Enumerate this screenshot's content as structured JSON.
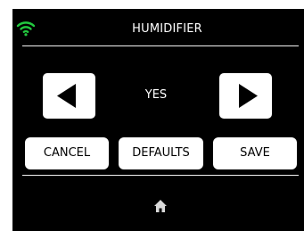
{
  "header": {
    "title": "HUMIDIFIER",
    "wifi_icon": "wifi-icon"
  },
  "selector": {
    "value": "YES",
    "previous_icon": "left-arrow-icon",
    "next_icon": "right-arrow-icon"
  },
  "actions": {
    "cancel_label": "CANCEL",
    "defaults_label": "DEFAULTS",
    "save_label": "SAVE"
  },
  "footer": {
    "home_icon": "home-icon"
  },
  "colors": {
    "panel_background": "#000000",
    "text": "#ffffff",
    "wifi": "#22c93f",
    "button_background": "#ffffff",
    "button_text": "#000000",
    "home_icon": "#d9d9d9"
  }
}
